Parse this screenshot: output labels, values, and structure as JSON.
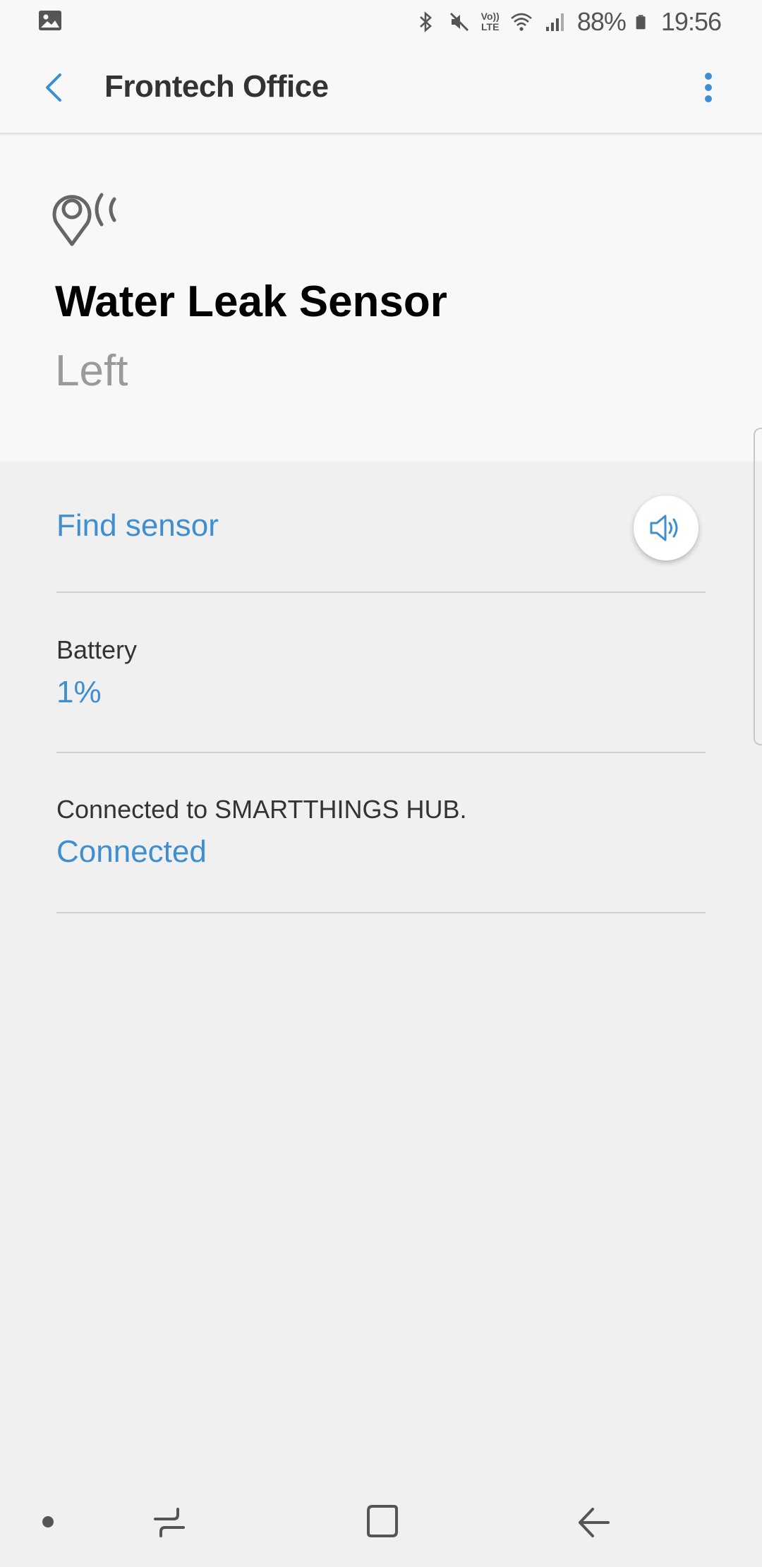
{
  "status_bar": {
    "left_icon": "image-icon",
    "volte_top": "Vo))",
    "volte_bottom": "LTE",
    "battery_percent": "88%",
    "time": "19:56"
  },
  "app_bar": {
    "title": "Frontech Office",
    "back_icon": "chevron-left-icon",
    "more_icon": "more-vertical-icon"
  },
  "device": {
    "icon": "location-signal-icon",
    "name": "Water Leak Sensor",
    "location": "Left"
  },
  "find_sensor": {
    "label": "Find sensor",
    "icon": "speaker-icon"
  },
  "battery": {
    "label": "Battery",
    "value": "1%"
  },
  "connection": {
    "label": "Connected to SMARTTHINGS HUB.",
    "value": "Connected"
  },
  "colors": {
    "accent": "#3e8ed0",
    "header_bg": "#f8f8f8",
    "content_bg": "#f0f0f0"
  }
}
